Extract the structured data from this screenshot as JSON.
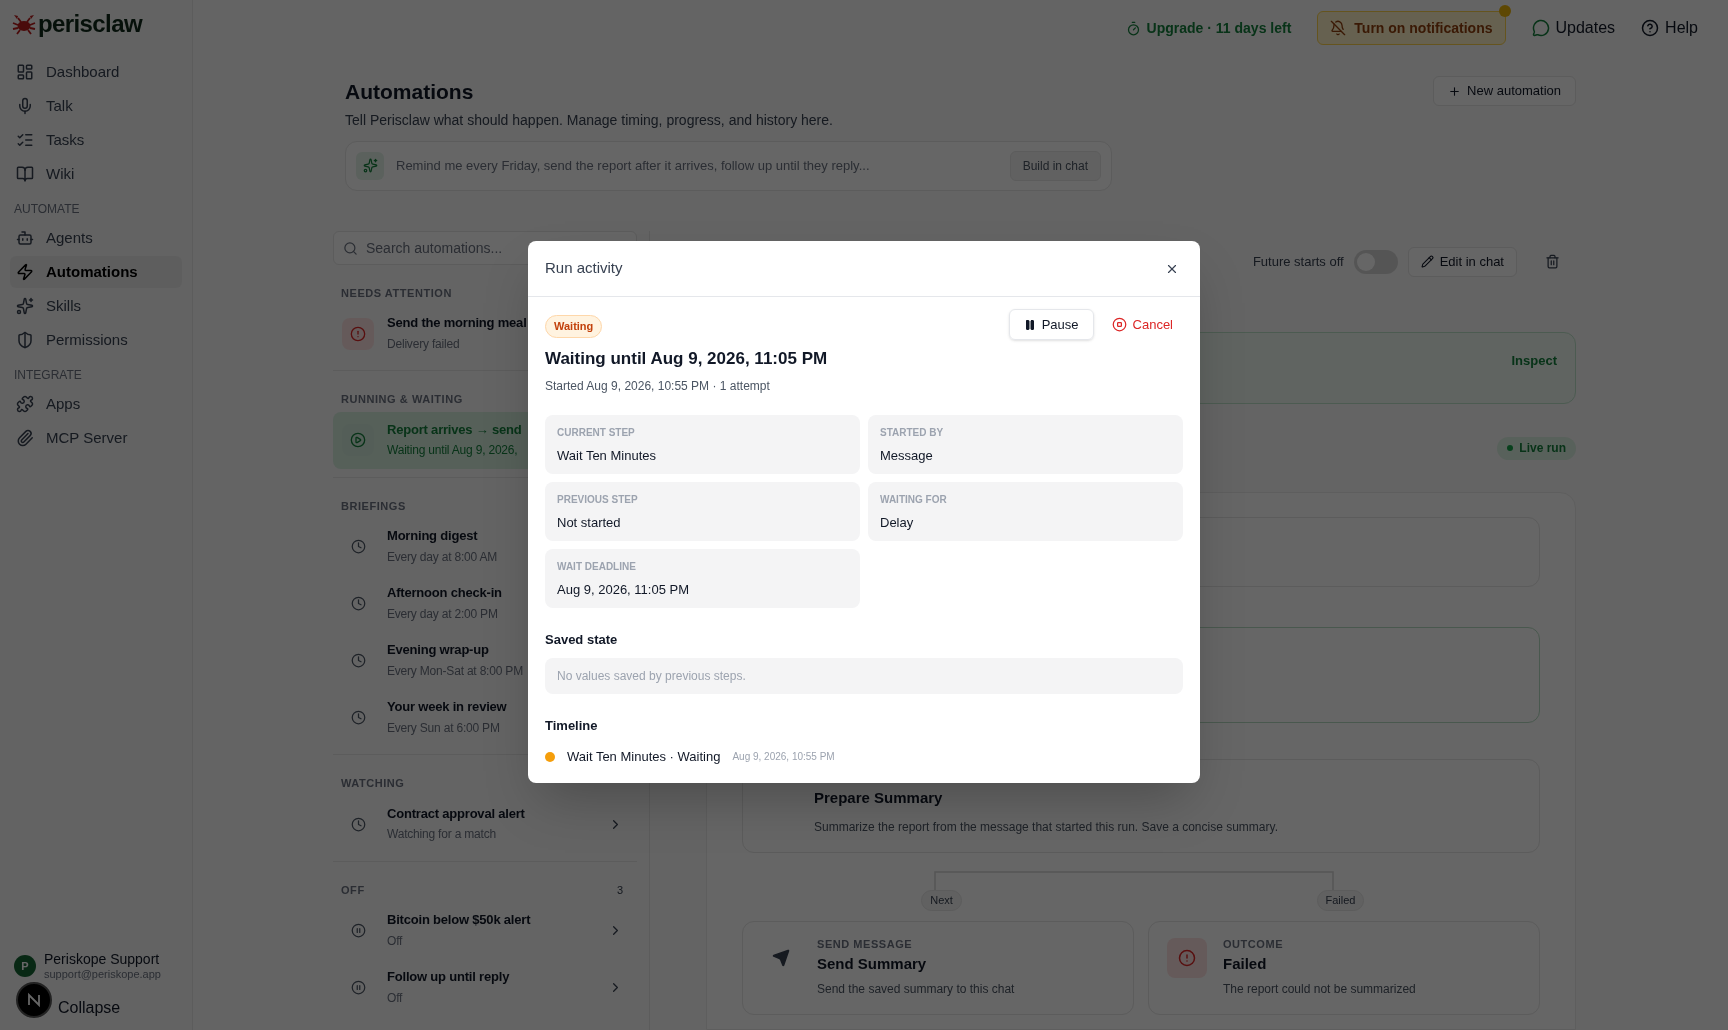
{
  "brand": {
    "name": "perisclaw"
  },
  "top_bar": {
    "upgrade": "Upgrade · 11 days left",
    "notifications": {
      "label": "Turn on notifications",
      "unread": true
    },
    "updates": "Updates",
    "help": "Help"
  },
  "sidebar": {
    "sections": [
      {
        "items": [
          {
            "label": "Dashboard",
            "selected": false
          },
          {
            "label": "Talk",
            "selected": false
          },
          {
            "label": "Tasks",
            "selected": false
          },
          {
            "label": "Wiki",
            "selected": false
          }
        ]
      },
      {
        "heading": "AUTOMATE",
        "items": [
          {
            "label": "Agents",
            "selected": false
          },
          {
            "label": "Automations",
            "selected": true
          },
          {
            "label": "Skills",
            "selected": false
          },
          {
            "label": "Permissions",
            "selected": false
          }
        ]
      },
      {
        "heading": "INTEGRATE",
        "items": [
          {
            "label": "Apps",
            "selected": false
          },
          {
            "label": "MCP Server",
            "selected": false
          }
        ]
      }
    ],
    "user": {
      "initial": "P",
      "name": "Periskope Support",
      "email": "support@periskope.app"
    },
    "collapse": "Collapse"
  },
  "page": {
    "title": "Automations",
    "subtitle": "Tell Perisclaw what should happen. Manage timing, progress, and history here.",
    "new_button": "New automation",
    "prompt": {
      "placeholder": "Remind me every Friday, send the report after it arrives, follow up until they reply...",
      "button": "Build in chat"
    }
  },
  "list": {
    "search": {
      "placeholder": "Search automations..."
    },
    "groups": [
      {
        "heading": "NEEDS ATTENTION",
        "items": [
          {
            "kind": "failed",
            "title": "Send the morning meal",
            "subtitle": "Delivery failed",
            "selected": false
          }
        ]
      },
      {
        "heading": "RUNNING & WAITING",
        "items": [
          {
            "kind": "running",
            "title": "Report arrives → send",
            "subtitle": "Waiting until Aug 9, 2026,",
            "selected": true
          }
        ]
      },
      {
        "heading": "BRIEFINGS",
        "items": [
          {
            "kind": "scheduled",
            "title": "Morning digest",
            "subtitle": "Every day at 8:00 AM",
            "selected": false
          },
          {
            "kind": "scheduled",
            "title": "Afternoon check-in",
            "subtitle": "Every day at 2:00 PM",
            "selected": false
          },
          {
            "kind": "scheduled",
            "title": "Evening wrap-up",
            "subtitle": "Every Mon-Sat at 8:00 PM",
            "selected": false
          },
          {
            "kind": "scheduled",
            "title": "Your week in review",
            "subtitle": "Every Sun at 6:00 PM",
            "selected": false
          }
        ]
      },
      {
        "heading": "WATCHING",
        "items": [
          {
            "kind": "watching",
            "title": "Contract approval alert",
            "subtitle": "Watching for a match",
            "selected": false
          }
        ]
      },
      {
        "heading": "OFF",
        "count": "3",
        "items": [
          {
            "kind": "off",
            "title": "Bitcoin below $50k alert",
            "subtitle": "Off",
            "selected": false
          },
          {
            "kind": "off",
            "title": "Follow up until reply",
            "subtitle": "Off",
            "selected": false
          }
        ]
      }
    ]
  },
  "detail": {
    "future_starts": {
      "label": "Future starts off",
      "on": false
    },
    "edit_button": "Edit in chat",
    "inspect": "Inspect",
    "live_badge": "Live run",
    "flow": {
      "step": {
        "title": "Prepare Summary",
        "description": "Summarize the report from the message that started this run. Save a concise summary."
      },
      "branches": [
        {
          "label": "Next",
          "node": {
            "kind": "send",
            "type": "SEND MESSAGE",
            "title": "Send Summary",
            "description": "Send the saved summary to this chat"
          }
        },
        {
          "label": "Failed",
          "node": {
            "kind": "failed",
            "type": "OUTCOME",
            "title": "Failed",
            "description": "The report could not be summarized"
          }
        }
      ]
    }
  },
  "modal": {
    "title": "Run activity",
    "status": "Waiting",
    "pause": "Pause",
    "cancel": "Cancel",
    "heading": "Waiting until Aug 9, 2026, 11:05 PM",
    "meta": "Started Aug 9, 2026, 10:55 PM · 1 attempt",
    "fields": [
      {
        "label": "CURRENT STEP",
        "value": "Wait Ten Minutes"
      },
      {
        "label": "STARTED BY",
        "value": "Message"
      },
      {
        "label": "PREVIOUS STEP",
        "value": "Not started"
      },
      {
        "label": "WAITING FOR",
        "value": "Delay"
      },
      {
        "label": "WAIT DEADLINE",
        "value": "Aug 9, 2026, 11:05 PM"
      }
    ],
    "saved_state": {
      "title": "Saved state",
      "empty": "No values saved by previous steps."
    },
    "timeline": {
      "title": "Timeline",
      "events": [
        {
          "label": "Wait Ten Minutes · Waiting",
          "time": "Aug 9, 2026, 10:55 PM",
          "color": "#f59e0b"
        }
      ]
    }
  }
}
